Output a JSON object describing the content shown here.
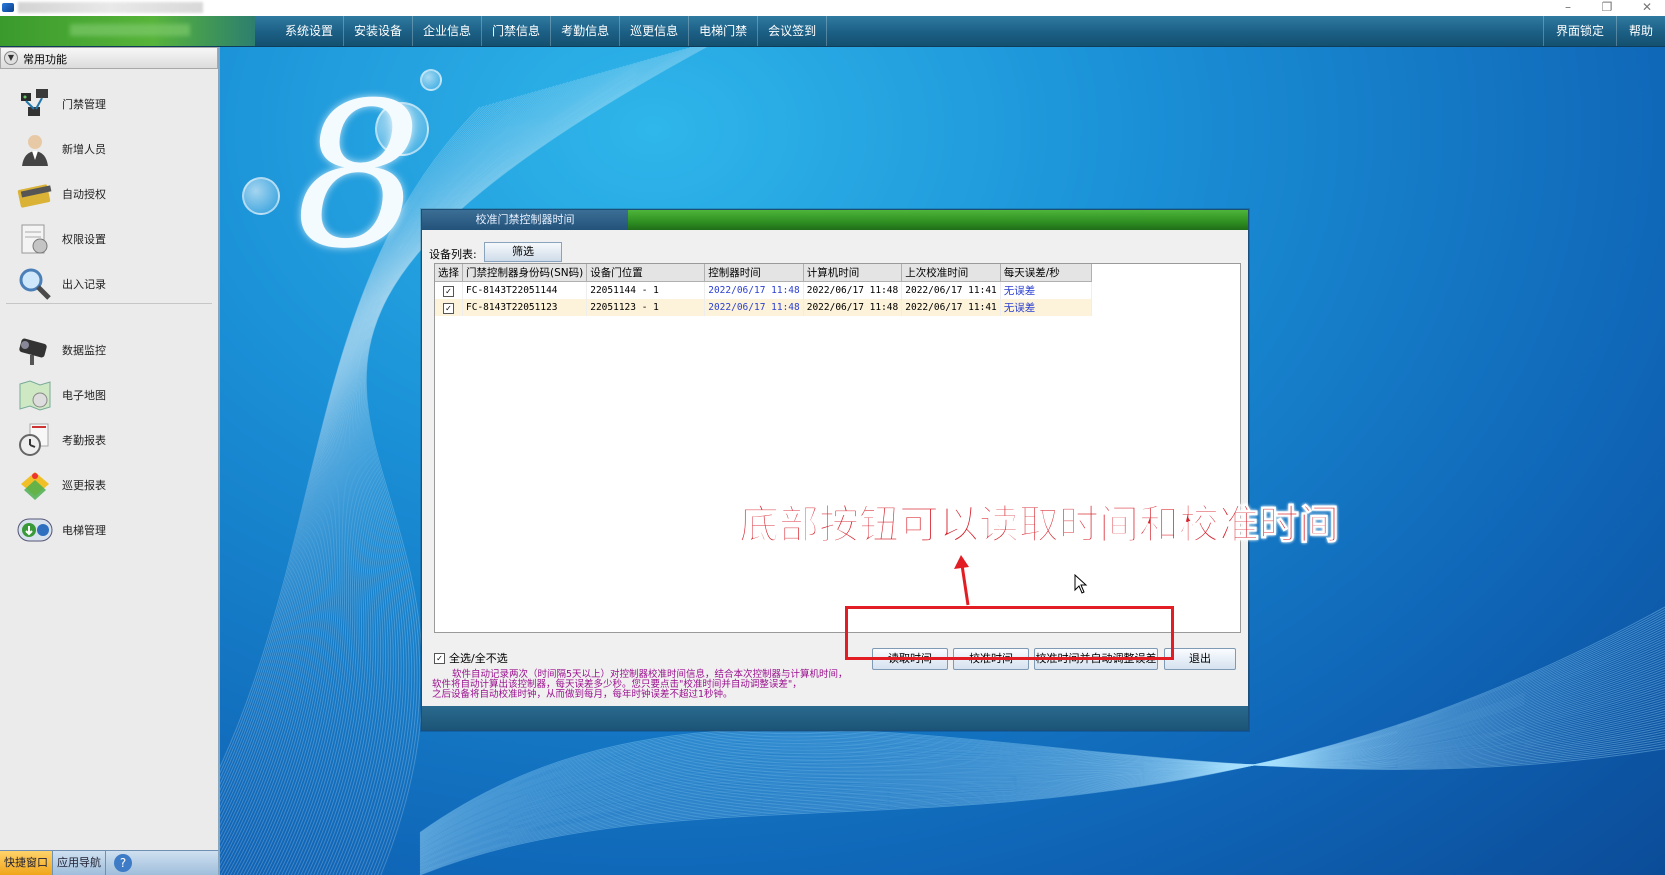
{
  "menu": {
    "items": [
      "系统设置",
      "安装设备",
      "企业信息",
      "门禁信息",
      "考勤信息",
      "巡更信息",
      "电梯门禁",
      "会议签到"
    ],
    "right_items": [
      "界面锁定",
      "帮助"
    ]
  },
  "sidebar": {
    "header": "常用功能",
    "items": [
      {
        "label": "门禁管理",
        "icon": "door-access-icon"
      },
      {
        "label": "新增人员",
        "icon": "person-icon"
      },
      {
        "label": "自动授权",
        "icon": "card-icon"
      },
      {
        "label": "权限设置",
        "icon": "permission-icon"
      },
      {
        "label": "出入记录",
        "icon": "magnifier-icon"
      },
      {
        "label": "数据监控",
        "icon": "camera-icon"
      },
      {
        "label": "电子地图",
        "icon": "map-icon"
      },
      {
        "label": "考勤报表",
        "icon": "clock-icon"
      },
      {
        "label": "巡更报表",
        "icon": "patrol-icon"
      },
      {
        "label": "电梯管理",
        "icon": "elevator-icon"
      }
    ],
    "footer_tabs": [
      "快捷窗口",
      "应用导航"
    ],
    "help": "?"
  },
  "desktop": {
    "logo": "8"
  },
  "dialog": {
    "title": "校准门禁控制器时间",
    "device_list_label": "设备列表:",
    "filter_button": "筛选",
    "columns": [
      "选择",
      "门禁控制器身份码(SN码)",
      "设备门位置",
      "控制器时间",
      "计算机时间",
      "上次校准时间",
      "每天误差/秒"
    ],
    "rows": [
      {
        "checked": true,
        "sn": "FC-8143T22051144",
        "door": "22051144 - 1",
        "controller_time": "2022/06/17 11:48",
        "pc_time": "2022/06/17 11:48",
        "last_cal": "2022/06/17 11:41",
        "error": "无误差"
      },
      {
        "checked": true,
        "sn": "FC-8143T22051123",
        "door": "22051123 - 1",
        "controller_time": "2022/06/17 11:48",
        "pc_time": "2022/06/17 11:48",
        "last_cal": "2022/06/17 11:41",
        "error": "无误差"
      }
    ],
    "select_all": "全选/全不选",
    "notes": [
      "软件自动记录两次（时间隔5天以上）对控制器校准时间信息，结合本次控制器与计算机时间，",
      "软件将自动计算出该控制器，每天误差多少秒。您只要点击\"校准时间并自动调整误差\"，",
      "之后设备将自动校准时钟，从而做到每月，每年时钟误差不超过1秒钟。"
    ],
    "buttons": {
      "read": "读取时间",
      "calibrate": "校准时间",
      "calibrate_adjust": "校准时间并自动调整误差",
      "exit": "退出"
    }
  },
  "annotation": {
    "text": "底部按钮可以读取时间和校准时间",
    "color": "#d6202a"
  },
  "colors": {
    "menu_bg": "#1c5f85",
    "brand_green": "#57b43a",
    "desktop_blue": "#1a8fd6",
    "annotation_red": "#e21d24"
  }
}
